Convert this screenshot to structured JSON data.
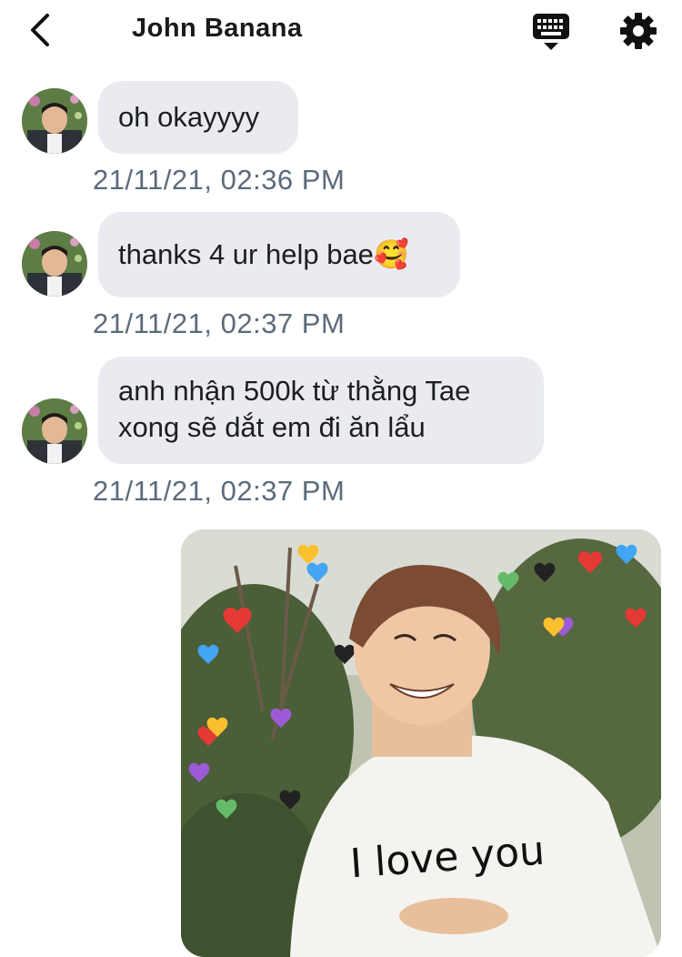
{
  "header": {
    "title": "John Banana",
    "back_icon": "chevron-left-icon",
    "keyboard_icon": "keyboard-icon",
    "settings_icon": "gear-icon"
  },
  "messages": [
    {
      "text": "oh okayyyy",
      "timestamp": "21/11/21, 02:36 PM"
    },
    {
      "text": "thanks 4 ur help bae",
      "emoji": "🥰",
      "timestamp": "21/11/21, 02:37 PM"
    },
    {
      "line1": "anh nhận 500k từ thằng Tae",
      "line2": "xong sẽ dắt em đi ăn lẩu",
      "timestamp": "21/11/21, 02:37 PM"
    }
  ],
  "sticker": {
    "caption": "I love you"
  },
  "colors": {
    "bubble": "#e9ebf0",
    "timestamp": "#5b6b7c",
    "title": "#1a1a1a"
  }
}
